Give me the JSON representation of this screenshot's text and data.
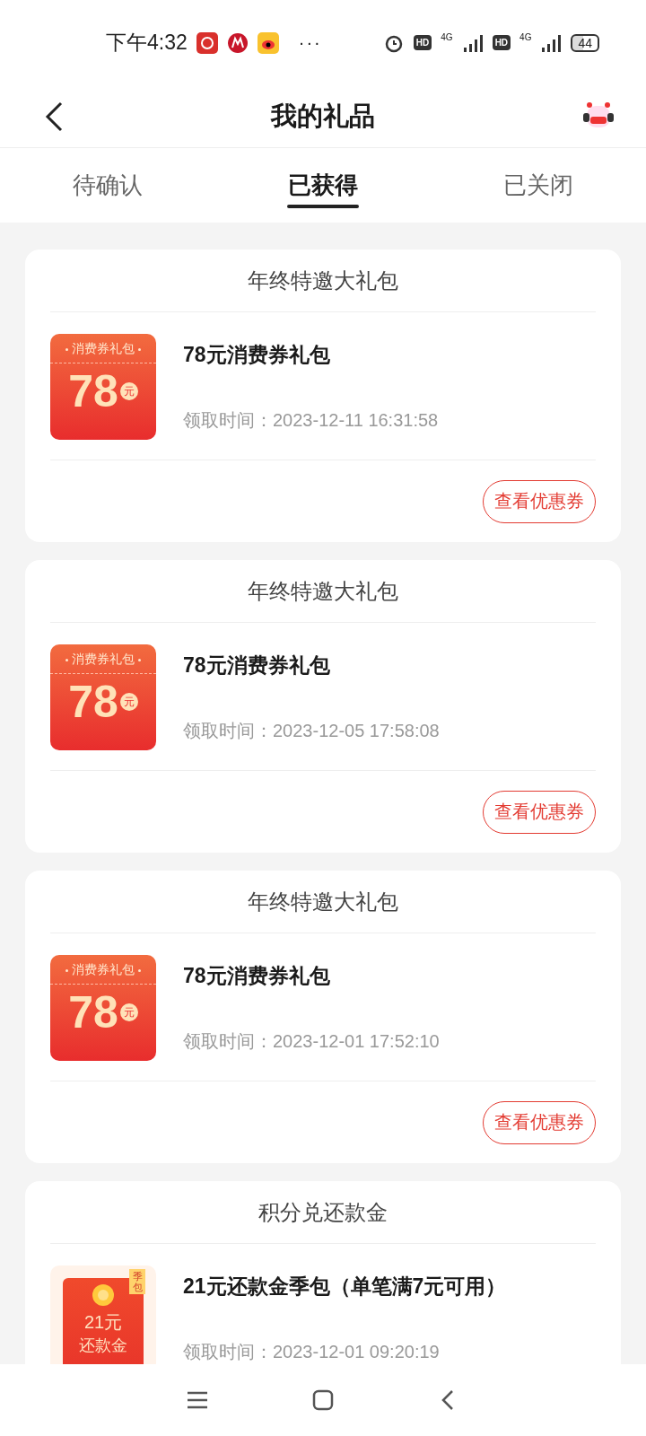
{
  "status_bar": {
    "time": "下午4:32",
    "more": "···",
    "sim1": {
      "hd": "HD",
      "network": "4G"
    },
    "sim2": {
      "hd": "HD",
      "network": "4G"
    },
    "battery": "44"
  },
  "header": {
    "title": "我的礼品"
  },
  "tabs": [
    {
      "label": "待确认",
      "selected": false
    },
    {
      "label": "已获得",
      "selected": true
    },
    {
      "label": "已关闭",
      "selected": false
    }
  ],
  "gifts": [
    {
      "group": "年终特邀大礼包",
      "name": "78元消费券礼包",
      "time": "领取时间：2023-12-11 16:31:58",
      "action": "查看优惠券",
      "badge": {
        "kind": "voucher",
        "label": "消费券礼包",
        "amount": "78",
        "unit": "元"
      }
    },
    {
      "group": "年终特邀大礼包",
      "name": "78元消费券礼包",
      "time": "领取时间：2023-12-05 17:58:08",
      "action": "查看优惠券",
      "badge": {
        "kind": "voucher",
        "label": "消费券礼包",
        "amount": "78",
        "unit": "元"
      }
    },
    {
      "group": "年终特邀大礼包",
      "name": "78元消费券礼包",
      "time": "领取时间：2023-12-01 17:52:10",
      "action": "查看优惠券",
      "badge": {
        "kind": "voucher",
        "label": "消费券礼包",
        "amount": "78",
        "unit": "元"
      }
    },
    {
      "group": "积分兑还款金",
      "name": "21元还款金季包（单笔满7元可用）",
      "time": "领取时间：2023-12-01 09:20:19",
      "badge": {
        "kind": "envelope",
        "tag": "季包",
        "amount": "21",
        "unit": "元",
        "label": "还款金"
      }
    }
  ]
}
